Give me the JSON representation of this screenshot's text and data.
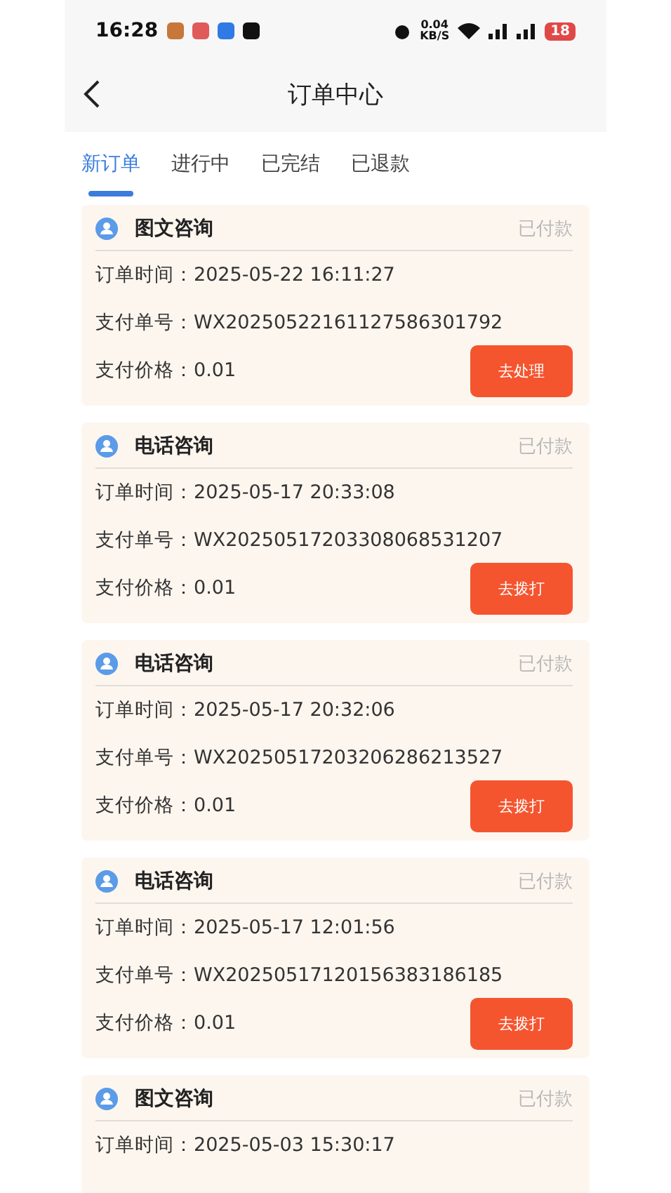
{
  "status_bar": {
    "time": "16:28",
    "net_speed": "0.04",
    "net_unit": "KB/S",
    "battery": "18"
  },
  "nav": {
    "title": "订单中心"
  },
  "tabs": [
    {
      "label": "新订单",
      "selected": true
    },
    {
      "label": "进行中",
      "selected": false
    },
    {
      "label": "已完结",
      "selected": false
    },
    {
      "label": "已退款",
      "selected": false
    }
  ],
  "orders": [
    {
      "type": "图文咨询",
      "status": "已付款",
      "time_label": "订单时间：",
      "time": "2025-05-22 16:11:27",
      "pay_no_label": "支付单号：",
      "pay_no": "WX20250522161127586301792",
      "price_label": "支付价格：",
      "price": "0.01",
      "action": "去处理"
    },
    {
      "type": "电话咨询",
      "status": "已付款",
      "time_label": "订单时间：",
      "time": "2025-05-17 20:33:08",
      "pay_no_label": "支付单号：",
      "pay_no": "WX20250517203308068531207",
      "price_label": "支付价格：",
      "price": "0.01",
      "action": "去拨打"
    },
    {
      "type": "电话咨询",
      "status": "已付款",
      "time_label": "订单时间：",
      "time": "2025-05-17 20:32:06",
      "pay_no_label": "支付单号：",
      "pay_no": "WX20250517203206286213527",
      "price_label": "支付价格：",
      "price": "0.01",
      "action": "去拨打"
    },
    {
      "type": "电话咨询",
      "status": "已付款",
      "time_label": "订单时间：",
      "time": "2025-05-17 12:01:56",
      "pay_no_label": "支付单号：",
      "pay_no": "WX20250517120156383186185",
      "price_label": "支付价格：",
      "price": "0.01",
      "action": "去拨打"
    },
    {
      "type": "图文咨询",
      "status": "已付款",
      "time_label": "订单时间：",
      "time": "2025-05-03 15:30:17"
    }
  ]
}
